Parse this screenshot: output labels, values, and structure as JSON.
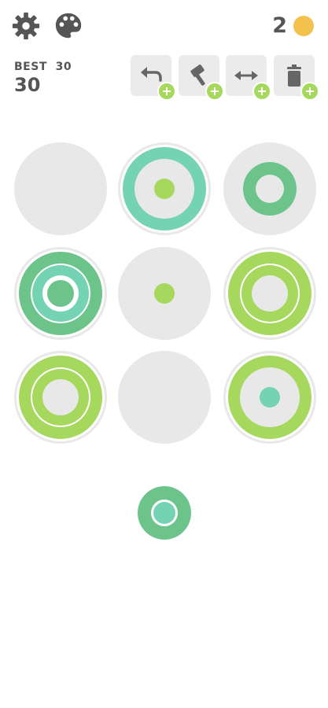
{
  "header": {
    "best_label": "BEST",
    "best_value": "30",
    "score": "30",
    "coins": "2"
  },
  "icons": {
    "settings": "gear-icon",
    "palette": "palette-icon",
    "coin": "coin-icon",
    "undo": "undo-icon",
    "hammer": "hammer-icon",
    "swap": "swap-arrows-icon",
    "trash": "trash-icon",
    "plus": "plus-icon"
  },
  "colors": {
    "teal": "#73d3b2",
    "green": "#6cc48a",
    "lime": "#a6d85e",
    "empty": "#e8e8e8",
    "coin": "#f2c14e"
  },
  "board": [
    {
      "large": null,
      "medium": null,
      "small": null
    },
    {
      "large": "teal",
      "medium": null,
      "small": "lime"
    },
    {
      "large": null,
      "medium": "green",
      "small": null
    },
    {
      "large": "green",
      "medium": "teal",
      "small": "green"
    },
    {
      "large": null,
      "medium": null,
      "small": "lime"
    },
    {
      "large": "lime",
      "medium": "lime",
      "small": null
    },
    {
      "large": "lime",
      "medium": "lime",
      "small": null
    },
    {
      "large": null,
      "medium": null,
      "small": null
    },
    {
      "large": "lime",
      "medium": null,
      "small": "teal"
    }
  ],
  "next_piece": {
    "large": null,
    "medium": "green",
    "small": "teal"
  }
}
